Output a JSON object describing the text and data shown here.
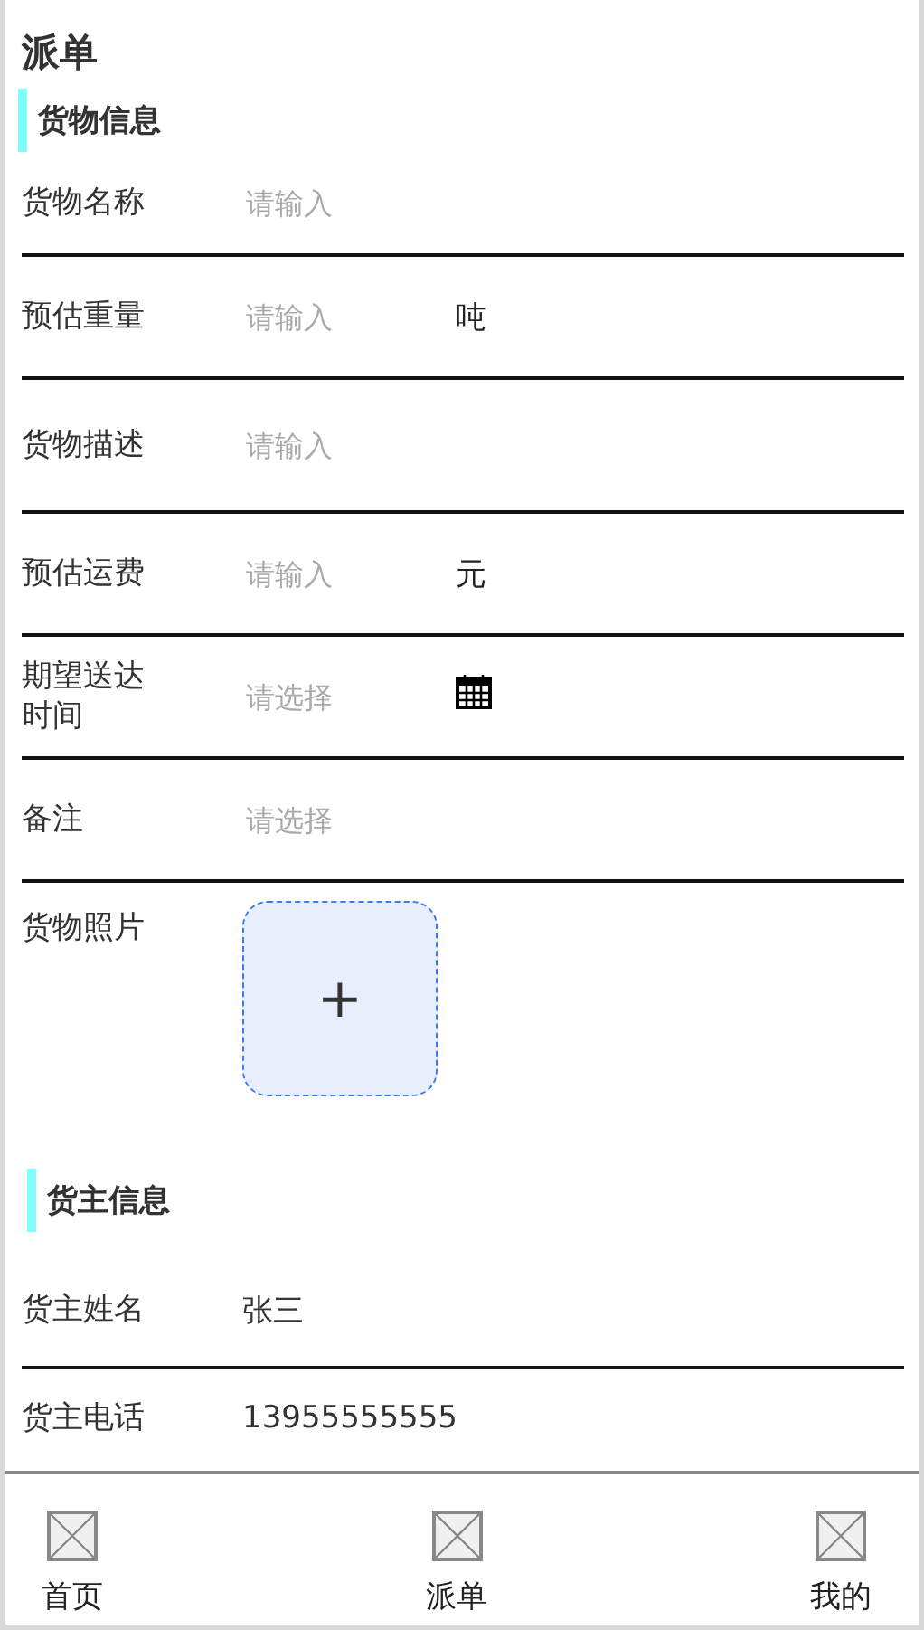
{
  "title": "派单",
  "sections": [
    {
      "title": "货物信息",
      "fields": [
        {
          "kind": "input",
          "label": "货物名称",
          "placeholder": "请输入"
        },
        {
          "kind": "input",
          "label": "预估重量",
          "placeholder": "请输入",
          "unit": "吨"
        },
        {
          "kind": "input",
          "label": "货物描述",
          "placeholder": "请输入"
        },
        {
          "kind": "input",
          "label": "预估运费",
          "placeholder": "请输入",
          "unit": "元"
        },
        {
          "kind": "date",
          "label": "期望送达时间",
          "placeholder": "请选择"
        },
        {
          "kind": "input",
          "label": "备注",
          "placeholder": "请选择"
        },
        {
          "kind": "upload",
          "label": "货物照片",
          "button": "+"
        }
      ]
    },
    {
      "title": "货主信息",
      "fields": [
        {
          "kind": "text",
          "label": "货主姓名",
          "value": "张三"
        },
        {
          "kind": "text",
          "label": "货主电话",
          "value": "13955555555"
        }
      ]
    }
  ],
  "tab_bar": [
    {
      "label": "首页"
    },
    {
      "label": "派单"
    },
    {
      "label": "我的"
    }
  ]
}
